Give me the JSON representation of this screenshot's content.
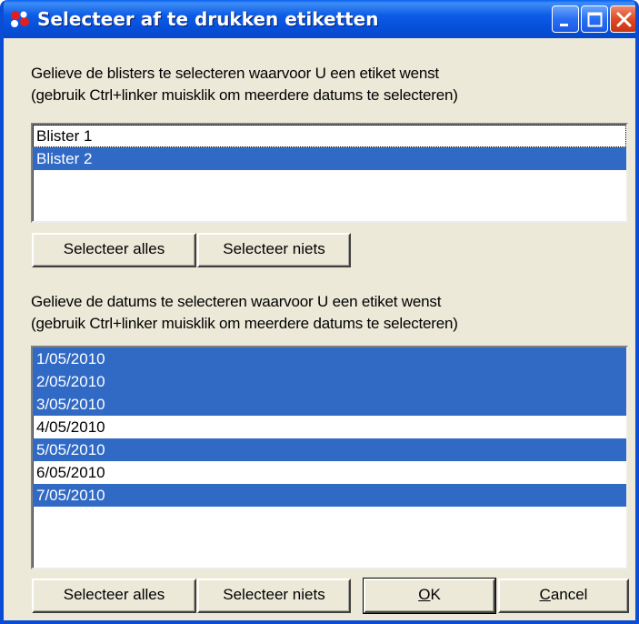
{
  "window": {
    "title": "Selecteer af te drukken etiketten",
    "controls": {
      "minimize": "minimize-icon",
      "maximize": "maximize-icon",
      "close": "close-icon"
    }
  },
  "blisters": {
    "instruction_line1": "Gelieve de blisters te selecteren waarvoor U een etiket wenst",
    "instruction_line2": "(gebruik Ctrl+linker muisklik om meerdere datums te selecteren)",
    "items": [
      {
        "label": "Blister 1",
        "selected": false,
        "focused": true
      },
      {
        "label": "Blister 2",
        "selected": true,
        "focused": false
      }
    ],
    "select_all_label": "Selecteer alles",
    "select_none_label": "Selecteer niets"
  },
  "dates": {
    "instruction_line1": "Gelieve de datums te selecteren waarvoor U een etiket wenst",
    "instruction_line2": "(gebruik Ctrl+linker muisklik om meerdere datums te selecteren)",
    "items": [
      {
        "label": "1/05/2010",
        "selected": true
      },
      {
        "label": "2/05/2010",
        "selected": true
      },
      {
        "label": "3/05/2010",
        "selected": true
      },
      {
        "label": "4/05/2010",
        "selected": false
      },
      {
        "label": "5/05/2010",
        "selected": true
      },
      {
        "label": "6/05/2010",
        "selected": false
      },
      {
        "label": "7/05/2010",
        "selected": true
      }
    ],
    "select_all_label": "Selecteer alles",
    "select_none_label": "Selecteer niets"
  },
  "dialog_buttons": {
    "ok_mnemonic": "O",
    "ok_rest": "K",
    "cancel_mnemonic": "C",
    "cancel_rest": "ancel"
  },
  "colors": {
    "selection": "#316ac5",
    "titlebar": "#0a5ce6",
    "dialog_background": "#ece9d8"
  }
}
